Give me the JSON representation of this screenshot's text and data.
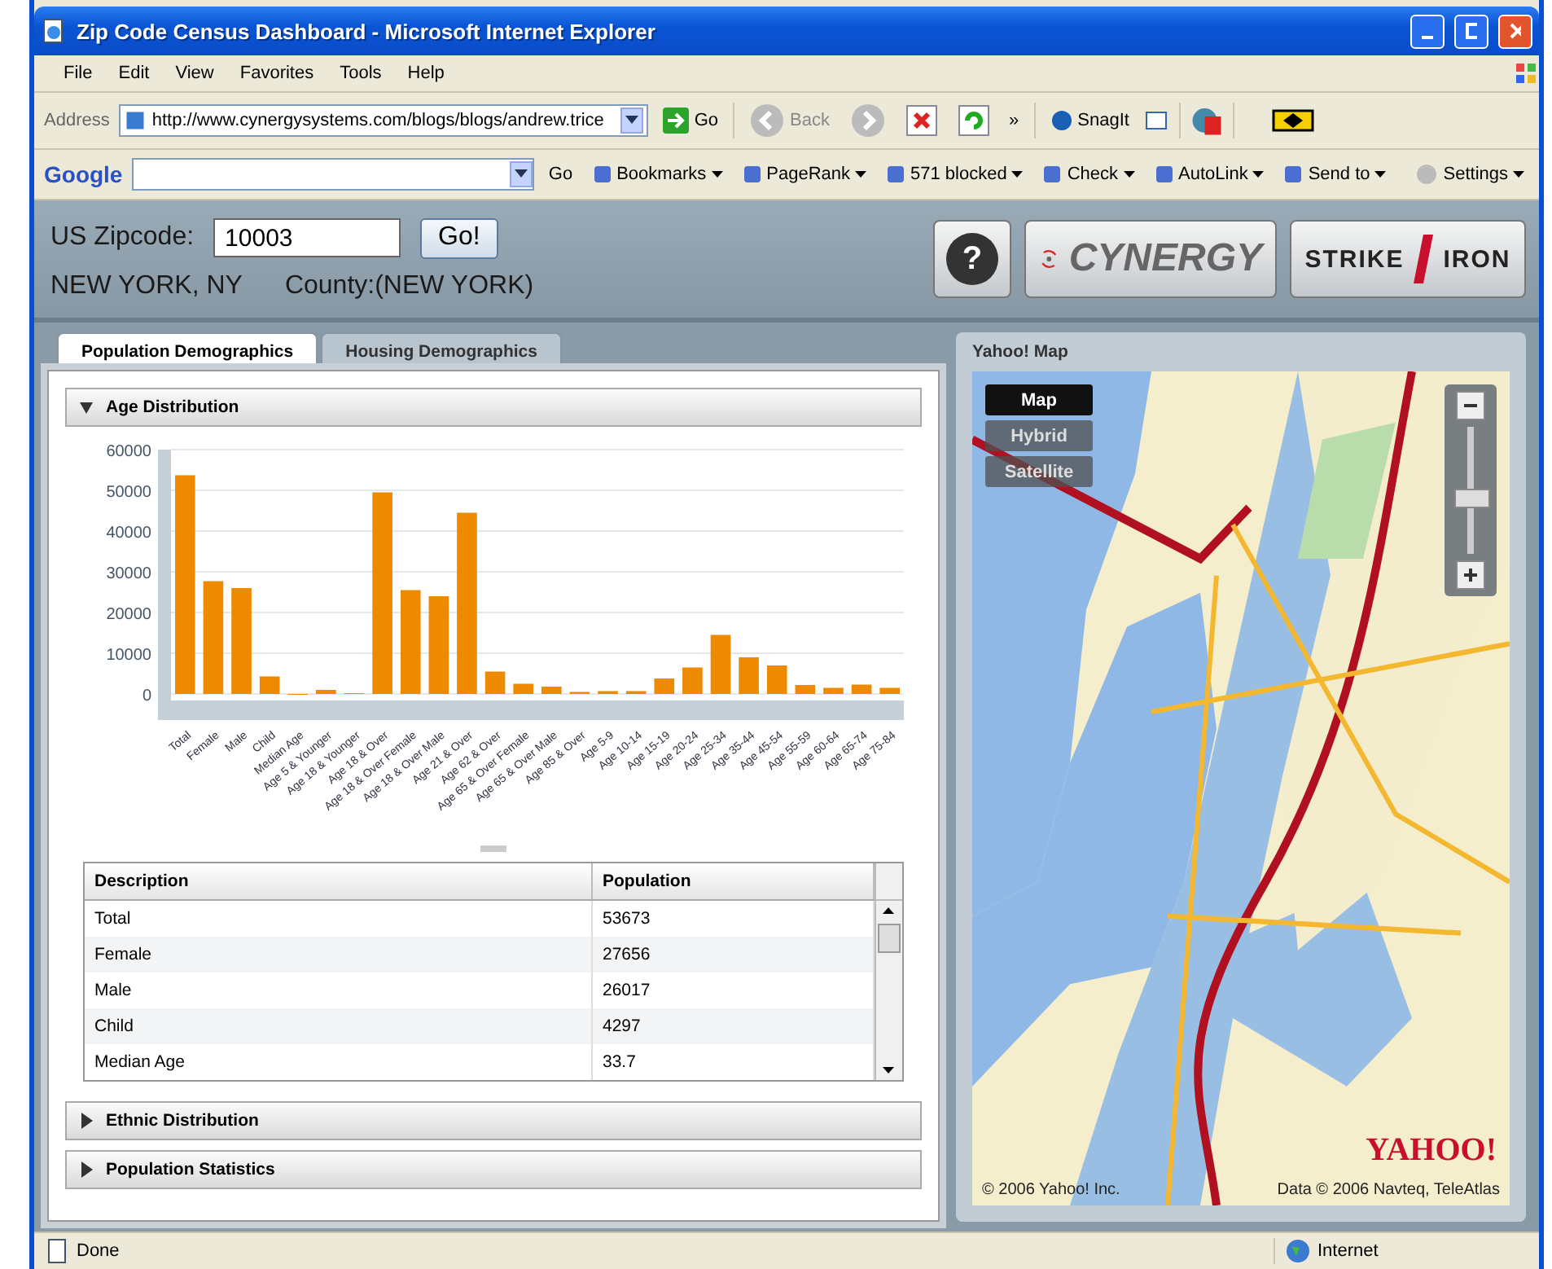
{
  "window": {
    "title": "Zip Code Census Dashboard - Microsoft Internet Explorer"
  },
  "menu": [
    "File",
    "Edit",
    "View",
    "Favorites",
    "Tools",
    "Help"
  ],
  "address_bar": {
    "label": "Address",
    "url": "http://www.cynergysystems.com/blogs/blogs/andrew.trice",
    "go": "Go",
    "back": "Back",
    "more": "»",
    "snagit": "SnagIt"
  },
  "google_toolbar": {
    "logo": "Google",
    "go": "Go",
    "items": [
      "Bookmarks",
      "PageRank",
      "571 blocked",
      "Check",
      "AutoLink",
      "Send to"
    ],
    "settings": "Settings"
  },
  "header": {
    "zip_label": "US Zipcode:",
    "zip_value": "10003",
    "go_button": "Go!",
    "city": "NEW YORK, NY",
    "county": "County:(NEW YORK)",
    "help": "?",
    "cynergy": "CYNERGY",
    "strike": "STRIKE",
    "iron": "IRON"
  },
  "tabs": [
    {
      "label": "Population Demographics",
      "selected": true
    },
    {
      "label": "Housing Demographics",
      "selected": false
    }
  ],
  "sections": [
    {
      "title": "Age Distribution",
      "expanded": true
    },
    {
      "title": "Ethnic Distribution",
      "expanded": false
    },
    {
      "title": "Population Statistics",
      "expanded": false
    }
  ],
  "chart_data": {
    "type": "bar",
    "categories": [
      "Total",
      "Female",
      "Male",
      "Child",
      "Median Age",
      "Age 5 & Younger",
      "Age 18 & Younger",
      "Age 18 & Over",
      "Age 18 & Over Female",
      "Age 18 & Over Male",
      "Age 21 & Over",
      "Age 62 & Over",
      "Age 65 & Over Female",
      "Age 65 & Over Male",
      "Age 85 & Over",
      "Age 5-9",
      "Age 10-14",
      "Age 15-19",
      "Age 20-24",
      "Age 25-34",
      "Age 35-44",
      "Age 45-54",
      "Age 55-59",
      "Age 60-64",
      "Age 65-74",
      "Age 75-84"
    ],
    "series": [
      {
        "color": "#ee8a00",
        "values": [
          53700,
          27700,
          26000,
          4300,
          0,
          1000,
          200,
          49500,
          25500,
          24000,
          44500,
          5500,
          2500,
          1800,
          500,
          700,
          700,
          3800,
          6500,
          14500,
          9000,
          7000,
          2200,
          1500,
          2300,
          1500
        ]
      }
    ],
    "ylim": [
      0,
      60000
    ],
    "yticks": [
      0,
      10000,
      20000,
      30000,
      40000,
      50000,
      60000
    ],
    "grid": true
  },
  "table": {
    "columns": [
      "Description",
      "Population"
    ],
    "rows": [
      [
        "Total",
        "53673"
      ],
      [
        "Female",
        "27656"
      ],
      [
        "Male",
        "26017"
      ],
      [
        "Child",
        "4297"
      ],
      [
        "Median Age",
        "33.7"
      ]
    ]
  },
  "map": {
    "title": "Yahoo! Map",
    "modes": [
      {
        "label": "Map",
        "selected": true
      },
      {
        "label": "Hybrid",
        "selected": false
      },
      {
        "label": "Satellite",
        "selected": false
      }
    ],
    "zoom": {
      "level": 0.45
    },
    "logo": "YAHOO!",
    "copyright": "© 2006 Yahoo! Inc.",
    "data_credit": "Data © 2006 Navteq, TeleAtlas"
  },
  "status_bar": {
    "text": "Done",
    "zone": "Internet"
  }
}
